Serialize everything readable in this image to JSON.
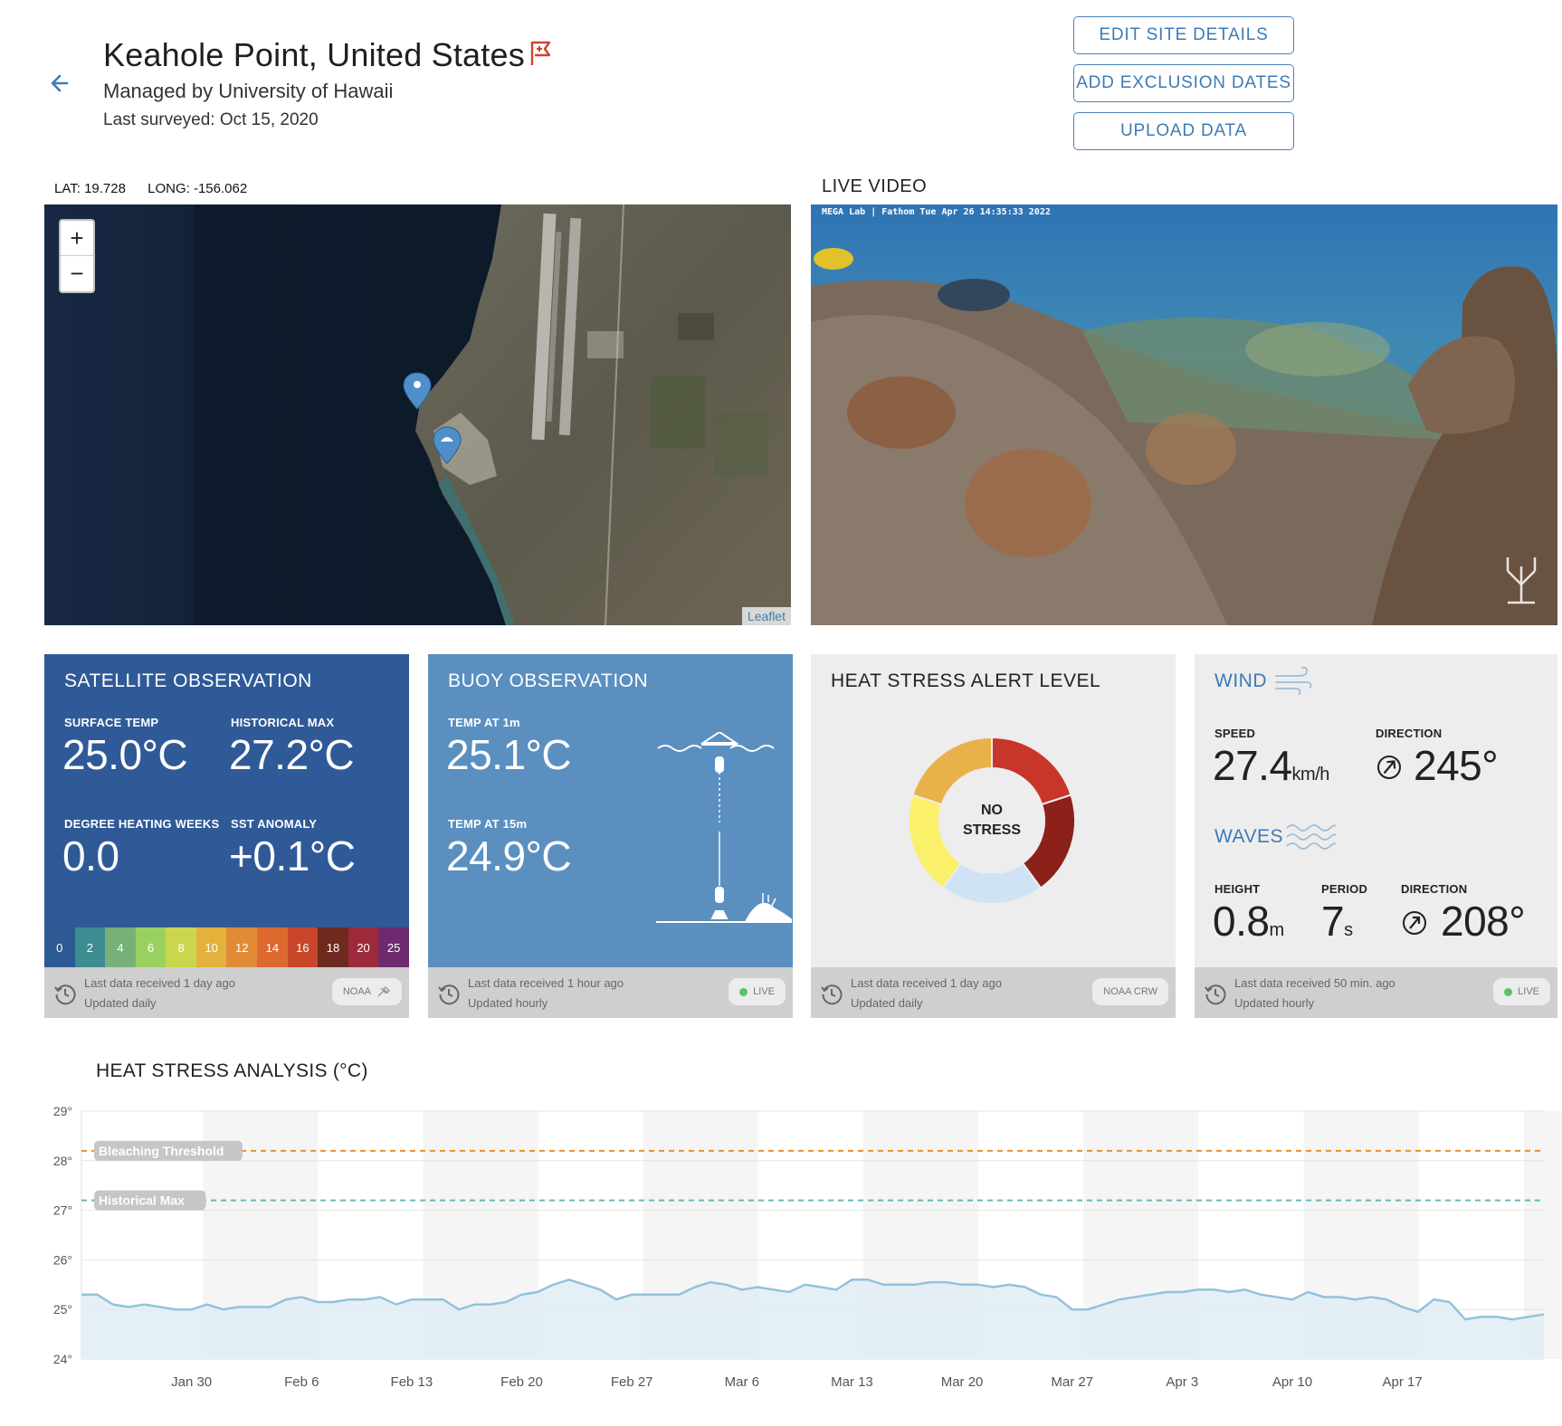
{
  "header": {
    "title": "Keahole Point, United States",
    "managed_by": "Managed by University of Hawaii",
    "last_surveyed": "Last surveyed: Oct 15, 2020",
    "buttons": {
      "edit": "EDIT SITE DETAILS",
      "exclusion": "ADD EXCLUSION DATES",
      "upload": "UPLOAD DATA"
    }
  },
  "map": {
    "lat": "LAT: 19.728",
    "long": "LONG: -156.062",
    "zoom_in": "+",
    "zoom_out": "−",
    "attribution": "Leaflet"
  },
  "video": {
    "title": "LIVE VIDEO",
    "caption": "MEGA Lab | Fathom Tue Apr 26 14:35:33 2022"
  },
  "satellite": {
    "title": "SATELLITE OBSERVATION",
    "surface_temp_label": "SURFACE TEMP",
    "surface_temp": "25.0°C",
    "historical_max_label": "HISTORICAL MAX",
    "historical_max": "27.2°C",
    "dhw_label": "DEGREE HEATING WEEKS",
    "dhw": "0.0",
    "sst_anomaly_label": "SST ANOMALY",
    "sst_anomaly": "+0.1°C",
    "scale": [
      "0",
      "2",
      "4",
      "6",
      "8",
      "10",
      "12",
      "14",
      "16",
      "18",
      "20",
      "25"
    ],
    "scale_colors": [
      "#2d5a93",
      "#3c8c92",
      "#78b07a",
      "#9ad060",
      "#c9d64e",
      "#e2b23c",
      "#e08c36",
      "#dc6a30",
      "#c8462a",
      "#6e2a1e",
      "#9c2a3a",
      "#6e2a6e"
    ],
    "footer_line1": "Last data received 1 day ago",
    "footer_line2": "Updated daily",
    "badge": "NOAA"
  },
  "buoy": {
    "title": "BUOY OBSERVATION",
    "temp1_label": "TEMP AT 1m",
    "temp1": "25.1°C",
    "temp15_label": "TEMP AT 15m",
    "temp15": "24.9°C",
    "footer_line1": "Last data received 1 hour ago",
    "footer_line2": "Updated hourly",
    "badge": "LIVE"
  },
  "heat_stress": {
    "title": "HEAT STRESS ALERT LEVEL",
    "status_line1": "NO",
    "status_line2": "STRESS",
    "footer_line1": "Last data received 1 day ago",
    "footer_line2": "Updated daily",
    "badge": "NOAA CRW",
    "colors": {
      "no_stress": "#cfe3f4",
      "watch": "#fbf06a",
      "warning": "#e8b149",
      "alert1": "#c8362b",
      "alert2": "#8b2119"
    }
  },
  "wind": {
    "title": "WIND",
    "speed_label": "SPEED",
    "speed": "27.4",
    "speed_unit": "km/h",
    "direction_label": "DIRECTION",
    "direction": "245°",
    "waves_title": "WAVES",
    "height_label": "HEIGHT",
    "height": "0.8",
    "height_unit": "m",
    "period_label": "PERIOD",
    "period": "7",
    "period_unit": "s",
    "wave_direction_label": "DIRECTION",
    "wave_direction": "208°",
    "footer_line1": "Last data received 50 min. ago",
    "footer_line2": "Updated hourly",
    "badge": "LIVE"
  },
  "colors": {
    "satellite_bg": "#2f5a97",
    "buoy_bg": "#5a8fc0",
    "card_gray": "#ededed",
    "accent_blue": "#3e7ab5",
    "bleaching_line": "#e8912e",
    "historical_line": "#67b7b8",
    "chart_line": "#93c2dc",
    "chart_fill": "#e1edf4"
  },
  "chart_data": {
    "type": "area",
    "title": "HEAT STRESS ANALYSIS (°C)",
    "ylim": [
      24,
      29
    ],
    "y_ticks": [
      "24°",
      "25°",
      "26°",
      "27°",
      "28°",
      "29°"
    ],
    "x_ticks": [
      "Jan 30",
      "Feb 6",
      "Feb 13",
      "Feb 20",
      "Feb 27",
      "Mar 6",
      "Mar 13",
      "Mar 20",
      "Mar 27",
      "Apr 3",
      "Apr 10",
      "Apr 17"
    ],
    "threshold_lines": [
      {
        "name": "Bleaching Threshold",
        "value": 28.2
      },
      {
        "name": "Historical Max",
        "value": 27.2
      }
    ],
    "series": [
      {
        "x": [
          "Jan 23",
          "Jan 24",
          "Jan 25",
          "Jan 26",
          "Jan 27",
          "Jan 28",
          "Jan 29",
          "Jan 30",
          "Jan 31",
          "Feb 1",
          "Feb 2",
          "Feb 3",
          "Feb 4",
          "Feb 5",
          "Feb 6",
          "Feb 7",
          "Feb 8",
          "Feb 9",
          "Feb 10",
          "Feb 11",
          "Feb 12",
          "Feb 13",
          "Feb 14",
          "Feb 15",
          "Feb 16",
          "Feb 17",
          "Feb 18",
          "Feb 19",
          "Feb 20",
          "Feb 21",
          "Feb 22",
          "Feb 23",
          "Feb 24",
          "Feb 25",
          "Feb 26",
          "Feb 27",
          "Feb 28",
          "Mar 1",
          "Mar 2",
          "Mar 3",
          "Mar 4",
          "Mar 5",
          "Mar 6",
          "Mar 7",
          "Mar 8",
          "Mar 9",
          "Mar 10",
          "Mar 11",
          "Mar 12",
          "Mar 13",
          "Mar 14",
          "Mar 15",
          "Mar 16",
          "Mar 17",
          "Mar 18",
          "Mar 19",
          "Mar 20",
          "Mar 21",
          "Mar 22",
          "Mar 23",
          "Mar 24",
          "Mar 25",
          "Mar 26",
          "Mar 27",
          "Mar 28",
          "Mar 29",
          "Mar 30",
          "Mar 31",
          "Apr 1",
          "Apr 2",
          "Apr 3",
          "Apr 4",
          "Apr 5",
          "Apr 6",
          "Apr 7",
          "Apr 8",
          "Apr 9",
          "Apr 10",
          "Apr 11",
          "Apr 12",
          "Apr 13",
          "Apr 14",
          "Apr 15",
          "Apr 16",
          "Apr 17",
          "Apr 18",
          "Apr 19",
          "Apr 20",
          "Apr 21",
          "Apr 22",
          "Apr 23",
          "Apr 24",
          "Apr 25",
          "Apr 26"
        ],
        "values": [
          25.3,
          25.3,
          25.1,
          25.05,
          25.1,
          25.05,
          25.0,
          25.0,
          25.1,
          25.0,
          25.05,
          25.05,
          25.05,
          25.2,
          25.25,
          25.15,
          25.15,
          25.2,
          25.2,
          25.25,
          25.1,
          25.2,
          25.2,
          25.2,
          25.0,
          25.1,
          25.1,
          25.15,
          25.3,
          25.35,
          25.5,
          25.6,
          25.5,
          25.4,
          25.2,
          25.3,
          25.3,
          25.3,
          25.3,
          25.45,
          25.55,
          25.5,
          25.4,
          25.45,
          25.4,
          25.35,
          25.5,
          25.45,
          25.4,
          25.6,
          25.6,
          25.5,
          25.5,
          25.5,
          25.55,
          25.55,
          25.5,
          25.5,
          25.45,
          25.5,
          25.45,
          25.3,
          25.25,
          25.0,
          25.0,
          25.1,
          25.2,
          25.25,
          25.3,
          25.35,
          25.35,
          25.4,
          25.4,
          25.35,
          25.4,
          25.3,
          25.25,
          25.2,
          25.35,
          25.25,
          25.25,
          25.2,
          25.25,
          25.2,
          25.05,
          24.95,
          25.2,
          25.15,
          24.8,
          24.85,
          24.85,
          24.8,
          24.85,
          24.9
        ]
      }
    ]
  }
}
